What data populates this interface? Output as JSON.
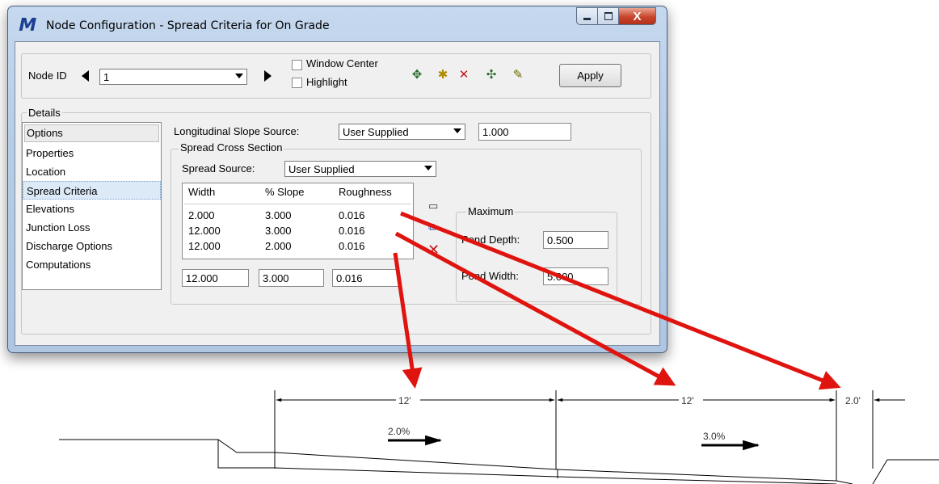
{
  "window": {
    "title": "Node Configuration - Spread Criteria for On Grade",
    "app_icon": "geopak-icon",
    "close_glyph": "X"
  },
  "toolbar": {
    "node_id_label": "Node ID",
    "node_id_value": "1",
    "window_center_label": "Window Center",
    "window_center_checked": false,
    "highlight_label": "Highlight",
    "highlight_checked": false,
    "apply_label": "Apply",
    "tool_icons": [
      "add-node-icon",
      "new-node-icon",
      "delete-node-icon",
      "node-list-icon",
      "node-report-icon"
    ]
  },
  "details": {
    "title": "Details",
    "options_header": "Options",
    "options": [
      "Properties",
      "Location",
      "Spread Criteria",
      "Elevations",
      "Junction Loss",
      "Discharge Options",
      "Computations"
    ],
    "selected_option": "Spread Criteria",
    "longitudinal_slope_source_label": "Longitudinal Slope Source:",
    "longitudinal_slope_source_value": "User Supplied",
    "longitudinal_slope_value": "1.000",
    "spread_cross_section": {
      "title": "Spread Cross Section",
      "spread_source_label": "Spread Source:",
      "spread_source_value": "User Supplied",
      "columns": [
        "Width",
        "% Slope",
        "Roughness"
      ],
      "rows": [
        [
          "2.000",
          "3.000",
          "0.016"
        ],
        [
          "12.000",
          "3.000",
          "0.016"
        ],
        [
          "12.000",
          "2.000",
          "0.016"
        ]
      ],
      "edit_values": [
        "12.000",
        "3.000",
        "0.016"
      ],
      "row_tool_icons": [
        "add-row-icon",
        "replace-row-icon",
        "delete-row-icon"
      ]
    },
    "maximum": {
      "title": "Maximum",
      "pond_depth_label": "Pond Depth:",
      "pond_depth_value": "0.500",
      "pond_width_label": "Pond Width:",
      "pond_width_value": "5.000"
    }
  },
  "diagram": {
    "dimensions": [
      "12'",
      "12'",
      "2.0'"
    ],
    "slopes": [
      "2.0%",
      "3.0%"
    ],
    "arrow_color": "#e0140f"
  }
}
